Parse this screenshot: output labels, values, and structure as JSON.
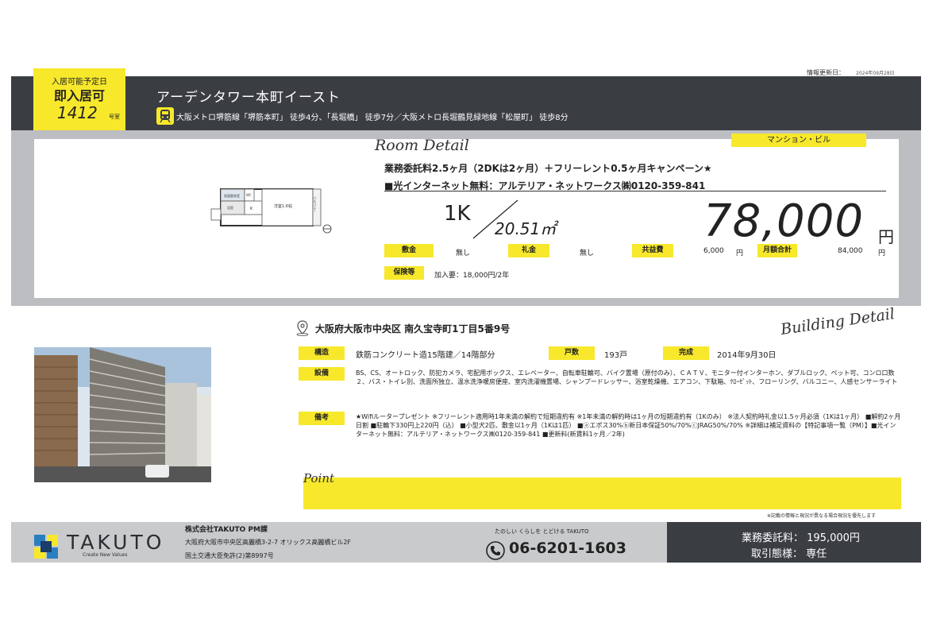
{
  "header": {
    "update_label": "情報更新日：",
    "update_date": "2024年09月28日",
    "property_name": "アーデンタワー本町イースト",
    "access": "大阪メトロ堺筋線「堺筋本町」 徒歩4分、「長堀橋」 徒歩7分／大阪メトロ長堀鶴見緑地線「松屋町」 徒歩8分"
  },
  "badge": {
    "line1": "入居可能予定日",
    "line2": "即入居可",
    "room_number": "1412",
    "room_suffix": "号室"
  },
  "room": {
    "section_title": "Room Detail",
    "type": "マンション・ビル",
    "campaign": "業務委託料2.5ヶ月（2DKは2ヶ月）＋フリーレント0.5ヶ月キャンペーン★",
    "internet": "■光インターネット無料：アルテリア・ネットワークス㈱0120-359-841",
    "layout": "1K",
    "area": "20.51㎡",
    "rent": "78,000",
    "rent_unit": "円",
    "deposit_label": "敷金",
    "deposit_value": "無し",
    "key_money_label": "礼金",
    "key_money_value": "無し",
    "common_fee_label": "共益費",
    "common_fee_value": "6,000",
    "common_fee_unit": "円",
    "monthly_total_label": "月額合計",
    "monthly_total_value": "84,000",
    "monthly_total_unit": "円",
    "guarantor_label": "保険等",
    "guarantor_value": "加入要：18,000円/2年"
  },
  "floorplan": {
    "room_label": "洋室1.6帖",
    "kitchen_label": "K",
    "bath_label": "浴室",
    "toilet_label": "WC",
    "wash_label": "洗面脱衣室",
    "balcony_label": "バルコニー"
  },
  "building": {
    "section_title": "Building Detail",
    "address": "大阪府大阪市中央区 南久宝寺町1丁目5番9号",
    "structure_label": "構造",
    "structure_value": "鉄筋コンクリート造15階建／14階部分",
    "units_label": "戸数",
    "units_value": "193戸",
    "completed_label": "完成",
    "completed_value": "2014年9月30日",
    "facilities_label": "設備",
    "facilities_value": "BS、CS、オートロック、防犯カメラ、宅配用ボックス、エレベーター、自転車駐輪可、バイク置場（原付のみ）、ＣＡＴＶ、モニター付インターホン、ダブルロック、ペット可、コンロ口数２、バス・トイレ別、洗面所独立、温水洗浄暖房便座、室内洗濯機置場、シャンプードレッサー、浴室乾燥機、エアコン、下駄箱、ｸﾛｰｾﾞｯﾄ、フローリング、バルコニー、人感センサーライト",
    "remarks_label": "備考",
    "remarks_value": "★Wifiルータープレゼント ※フリーレント適用時1年未満の解約で短期違約有 ※1年未満の解約時は1ヶ月の短期違約有（1Kのみ） ※法人契約時礼金以1.5ヶ月必須（1Kは1ヶ月） ■解約2ヶ月日割 ■駐輪下330円上220円（込） ■小型犬2匹、敷金以1ヶ月（1Kは1匹） ■ⓐエポス30%ⓑ新日本保証50%/70%ⓒJRAG50%/70% ※詳細は補足資料の【特記事項一覧（PM）】■光インターネット無料：アルテリア・ネットワークス㈱0120-359-841 ■更新料(新賃料1ヶ月／2年)"
  },
  "point": {
    "title": "Point",
    "text": ""
  },
  "disclaimer": "※記載の情報と現況が異なる場合現況を優先します",
  "footer": {
    "logo_text": "TAKUTO",
    "logo_sub": "Create New Values",
    "company": "株式会社TAKUTO PM課",
    "address": "大阪府大阪市中央区高麗橋3-2-7 オリックス高麗橋ビル2F",
    "license": "国土交通大臣免許(2)第8997号",
    "slogan": "たのしい くらしを とどける TAKUTO",
    "phone": "06-6201-1603",
    "fee": "業務委託料： 195,000円",
    "deal": "取引態様： 専任"
  },
  "colors": {
    "accent": "#f7e82b",
    "dark": "#3a3d42",
    "panel": "#bcbec1"
  }
}
